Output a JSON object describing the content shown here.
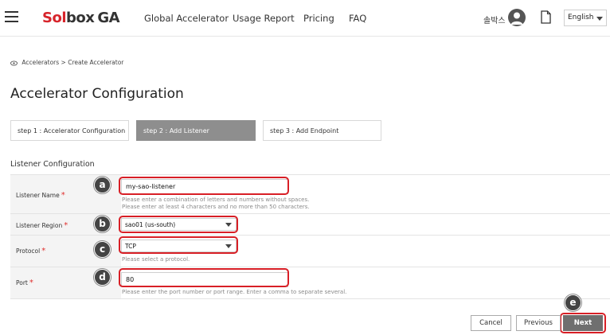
{
  "header": {
    "logo": {
      "sol": "Sol",
      "box": "box",
      "ga": "GA"
    },
    "nav": [
      "Global Accelerator",
      "Usage Report",
      "Pricing",
      "FAQ"
    ],
    "user_name": "솔박스",
    "language": "English"
  },
  "breadcrumb": {
    "parent": "Accelerators",
    "separator": ">",
    "current": "Create Accelerator"
  },
  "page_title": "Accelerator Configuration",
  "steps": [
    {
      "label": "step 1 : Accelerator Configuration"
    },
    {
      "label": "step 2 : Add Listener"
    },
    {
      "label": "step 3 : Add Endpoint"
    }
  ],
  "section_title": "Listener Configuration",
  "form": {
    "listener_name": {
      "label": "Listener Name",
      "value": "my-sao-listener",
      "hint1": "Please enter a combination of letters and numbers without spaces.",
      "hint2": "Please enter at least 4 characters and no more than 50 characters."
    },
    "listener_region": {
      "label": "Listener Region",
      "value": "sao01 (us-south)"
    },
    "protocol": {
      "label": "Protocol",
      "value": "TCP",
      "hint": "Please select a protocol."
    },
    "port": {
      "label": "Port",
      "value": "80",
      "hint": "Please enter the port number or port range. Enter a comma to separate several."
    },
    "required_mark": "*"
  },
  "annotations": [
    "a",
    "b",
    "c",
    "d",
    "e"
  ],
  "buttons": {
    "cancel": "Cancel",
    "previous": "Previous",
    "next": "Next"
  },
  "colors": {
    "brand_red": "#d7242b",
    "annotation_red": "#d81f26",
    "active_step": "#8e8e8e",
    "next_button": "#6f6f6f"
  }
}
